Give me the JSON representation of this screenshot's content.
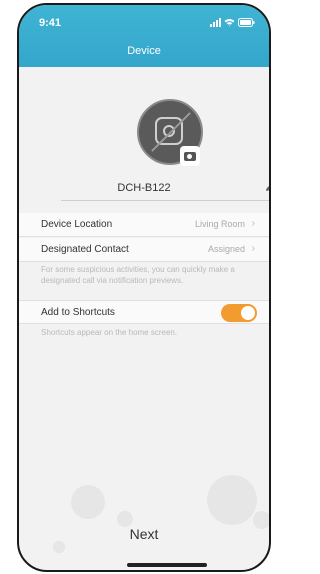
{
  "status_bar": {
    "time": "9:41"
  },
  "header": {
    "title": "Device"
  },
  "device": {
    "name": "DCH-B122"
  },
  "settings": {
    "location": {
      "label": "Device Location",
      "value": "Living Room"
    },
    "contact": {
      "label": "Designated Contact",
      "value": "Assigned"
    },
    "contact_hint": "For some suspicious activities, you can quickly make a designated call via notification previews.",
    "shortcuts": {
      "label": "Add to Shortcuts",
      "enabled": true
    },
    "shortcuts_hint": "Shortcuts appear on the home screen."
  },
  "footer": {
    "next_label": "Next"
  },
  "colors": {
    "header": "#3fb4d3",
    "toggle_on": "#f29b2e"
  }
}
